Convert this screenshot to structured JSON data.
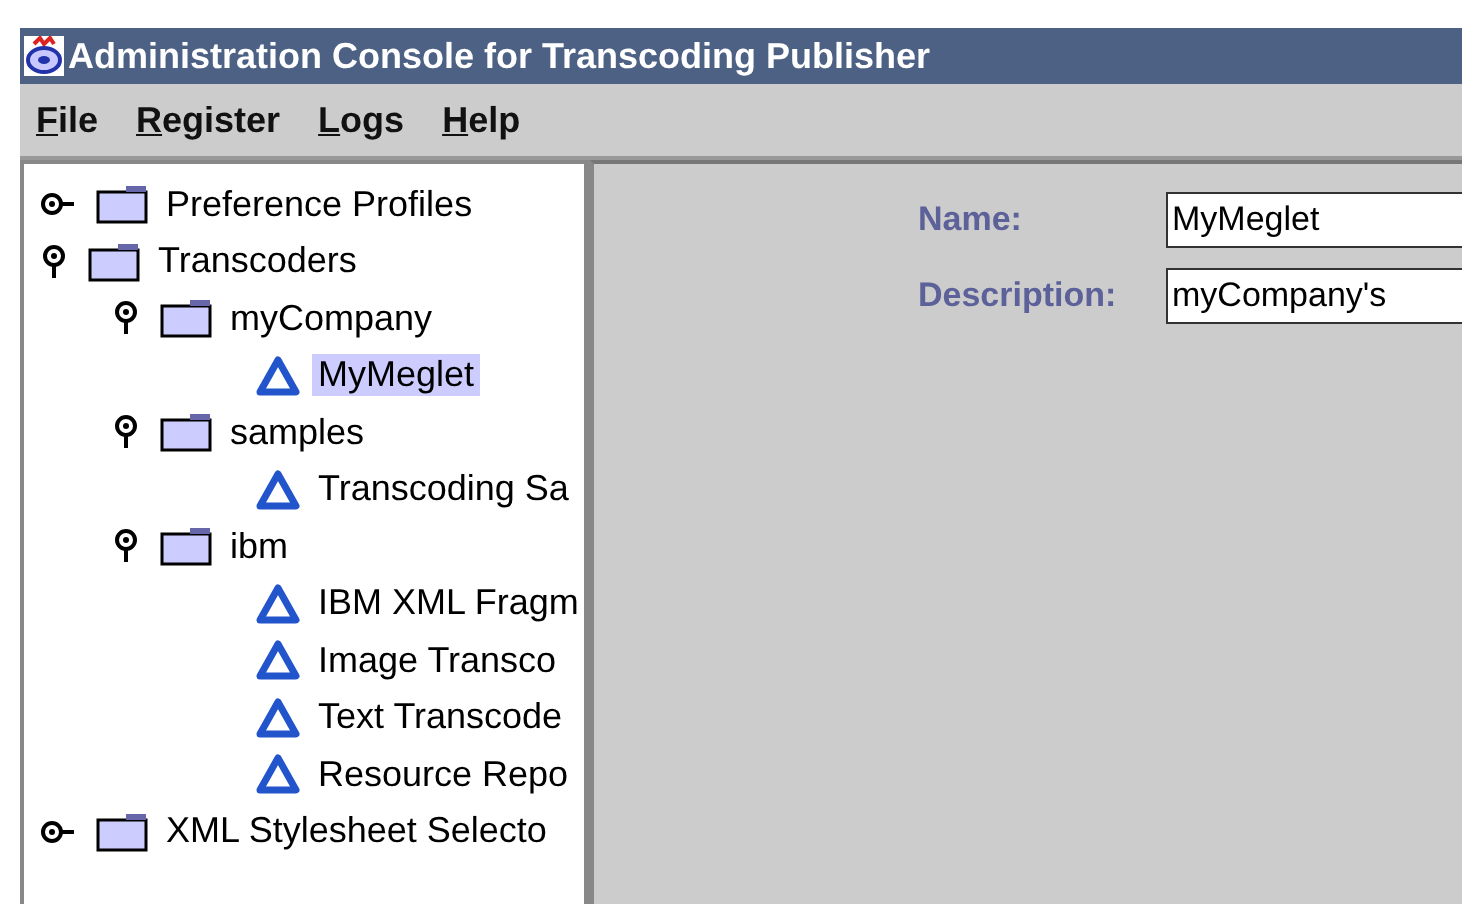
{
  "window": {
    "title": "Administration Console for Transcoding Publisher"
  },
  "menu": [
    "File",
    "Register",
    "Logs",
    "Help"
  ],
  "tree": [
    {
      "label": "Preference Profiles",
      "kind": "folder",
      "expanded": false,
      "selected": false
    },
    {
      "label": "Transcoders",
      "kind": "folder",
      "expanded": true,
      "selected": false,
      "children": [
        {
          "label": "myCompany",
          "kind": "folder",
          "expanded": true,
          "selected": false,
          "children": [
            {
              "label": "MyMeglet",
              "kind": "leaf",
              "selected": true
            }
          ]
        },
        {
          "label": "samples",
          "kind": "folder",
          "expanded": true,
          "selected": false,
          "children": [
            {
              "label": "Transcoding Sa",
              "kind": "leaf",
              "selected": false
            }
          ]
        },
        {
          "label": "ibm",
          "kind": "folder",
          "expanded": true,
          "selected": false,
          "children": [
            {
              "label": "IBM XML Fragm",
              "kind": "leaf",
              "selected": false
            },
            {
              "label": "Image Transco",
              "kind": "leaf",
              "selected": false
            },
            {
              "label": "Text Transcode",
              "kind": "leaf",
              "selected": false
            },
            {
              "label": "Resource Repo",
              "kind": "leaf",
              "selected": false
            }
          ]
        }
      ]
    },
    {
      "label": "XML Stylesheet Selecto",
      "kind": "folder",
      "expanded": false,
      "selected": false
    }
  ],
  "form": [
    {
      "label": "Name:",
      "value": "MyMeglet"
    },
    {
      "label": "Description:",
      "value": "myCompany's"
    }
  ]
}
